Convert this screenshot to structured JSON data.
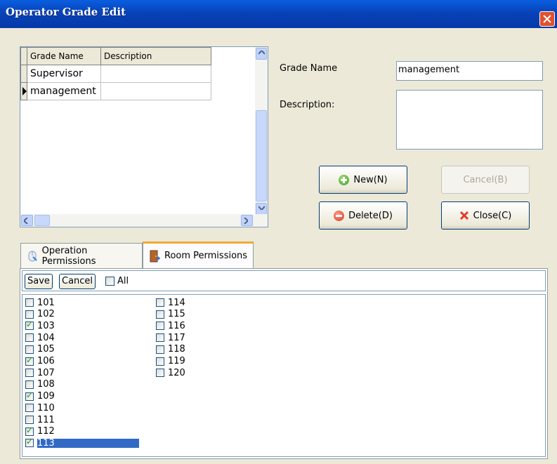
{
  "window": {
    "title": "Operator Grade Edit"
  },
  "grid": {
    "columns": [
      "Grade Name",
      "Description"
    ],
    "rows": [
      {
        "name": "Supervisor",
        "description": ""
      },
      {
        "name": "management",
        "description": ""
      }
    ]
  },
  "form": {
    "grade_name_label": "Grade Name",
    "grade_name_value": "management",
    "description_label": "Description:",
    "description_value": ""
  },
  "buttons": {
    "new": "New(N)",
    "cancel": "Cancel(B)",
    "delete": "Delete(D)",
    "close": "Close(C)"
  },
  "tabs": [
    {
      "label": "Operation Permissions",
      "active": false
    },
    {
      "label": "Room Permissions",
      "active": true
    }
  ],
  "room_panel": {
    "save_label": "Save",
    "cancel_label": "Cancel",
    "all_label": "All",
    "rooms": [
      {
        "label": "101",
        "checked": false
      },
      {
        "label": "102",
        "checked": false
      },
      {
        "label": "103",
        "checked": true
      },
      {
        "label": "104",
        "checked": false
      },
      {
        "label": "105",
        "checked": false
      },
      {
        "label": "106",
        "checked": true
      },
      {
        "label": "107",
        "checked": false
      },
      {
        "label": "108",
        "checked": false
      },
      {
        "label": "109",
        "checked": true
      },
      {
        "label": "110",
        "checked": false
      },
      {
        "label": "111",
        "checked": false
      },
      {
        "label": "112",
        "checked": true
      },
      {
        "label": "113",
        "checked": true,
        "selected": true
      },
      {
        "label": "114",
        "checked": false
      },
      {
        "label": "115",
        "checked": false
      },
      {
        "label": "116",
        "checked": false
      },
      {
        "label": "117",
        "checked": false
      },
      {
        "label": "118",
        "checked": false
      },
      {
        "label": "119",
        "checked": false
      },
      {
        "label": "120",
        "checked": false
      }
    ]
  }
}
